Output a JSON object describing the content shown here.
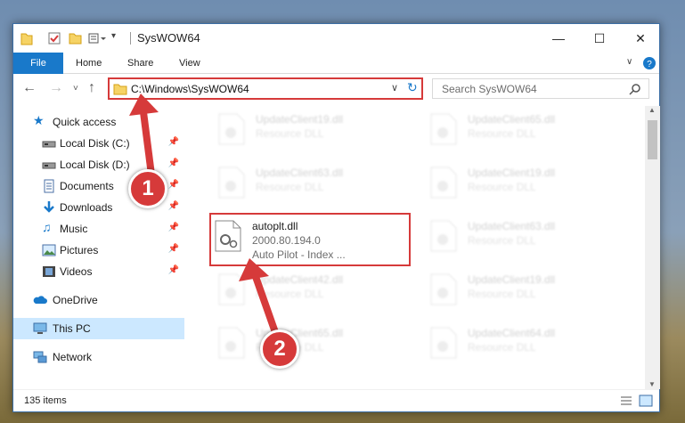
{
  "window": {
    "title": "SysWOW64"
  },
  "ribbon": {
    "tabs": [
      "File",
      "Home",
      "Share",
      "View"
    ]
  },
  "address": {
    "path": "C:\\Windows\\SysWOW64"
  },
  "search": {
    "placeholder": "Search SysWOW64"
  },
  "sidebar": {
    "quick_access": "Quick access",
    "items": [
      {
        "label": "Local Disk (C:)",
        "icon": "drive-icon",
        "pinned": true
      },
      {
        "label": "Local Disk (D:)",
        "icon": "drive-icon",
        "pinned": true
      },
      {
        "label": "Documents",
        "icon": "documents-icon",
        "pinned": true
      },
      {
        "label": "Downloads",
        "icon": "downloads-icon",
        "pinned": true
      },
      {
        "label": "Music",
        "icon": "music-icon",
        "pinned": true
      },
      {
        "label": "Pictures",
        "icon": "pictures-icon",
        "pinned": true
      },
      {
        "label": "Videos",
        "icon": "videos-icon",
        "pinned": true
      }
    ],
    "onedrive": "OneDrive",
    "this_pc": "This PC",
    "network": "Network"
  },
  "files": {
    "col1": [
      {
        "name": "UpdateClient19.dll",
        "type": "Resource DLL"
      },
      {
        "name": "UpdateClient63.dll",
        "type": "Resource DLL"
      },
      {
        "name": "autoplt.dll",
        "version": "2000.80.194.0",
        "desc": "Auto Pilot - Index ..."
      },
      {
        "name": "UpdateClient42.dll",
        "type": "Resource DLL"
      },
      {
        "name": "UpdateClient65.dll",
        "type": "Resource DLL"
      }
    ],
    "col2": [
      {
        "name": "UpdateClient65.dll",
        "type": "Resource DLL"
      },
      {
        "name": "UpdateClient19.dll",
        "type": "Resource DLL"
      },
      {
        "name": "UpdateClient63.dll",
        "type": "Resource DLL"
      },
      {
        "name": "UpdateClient19.dll",
        "type": "Resource DLL"
      },
      {
        "name": "UpdateClient64.dll",
        "type": "Resource DLL"
      }
    ]
  },
  "status": {
    "count": "135 items"
  },
  "annotations": {
    "step1": "1",
    "step2": "2"
  },
  "colors": {
    "accent": "#1979ca",
    "highlight": "#d63a3a",
    "selected": "#cce8ff"
  }
}
